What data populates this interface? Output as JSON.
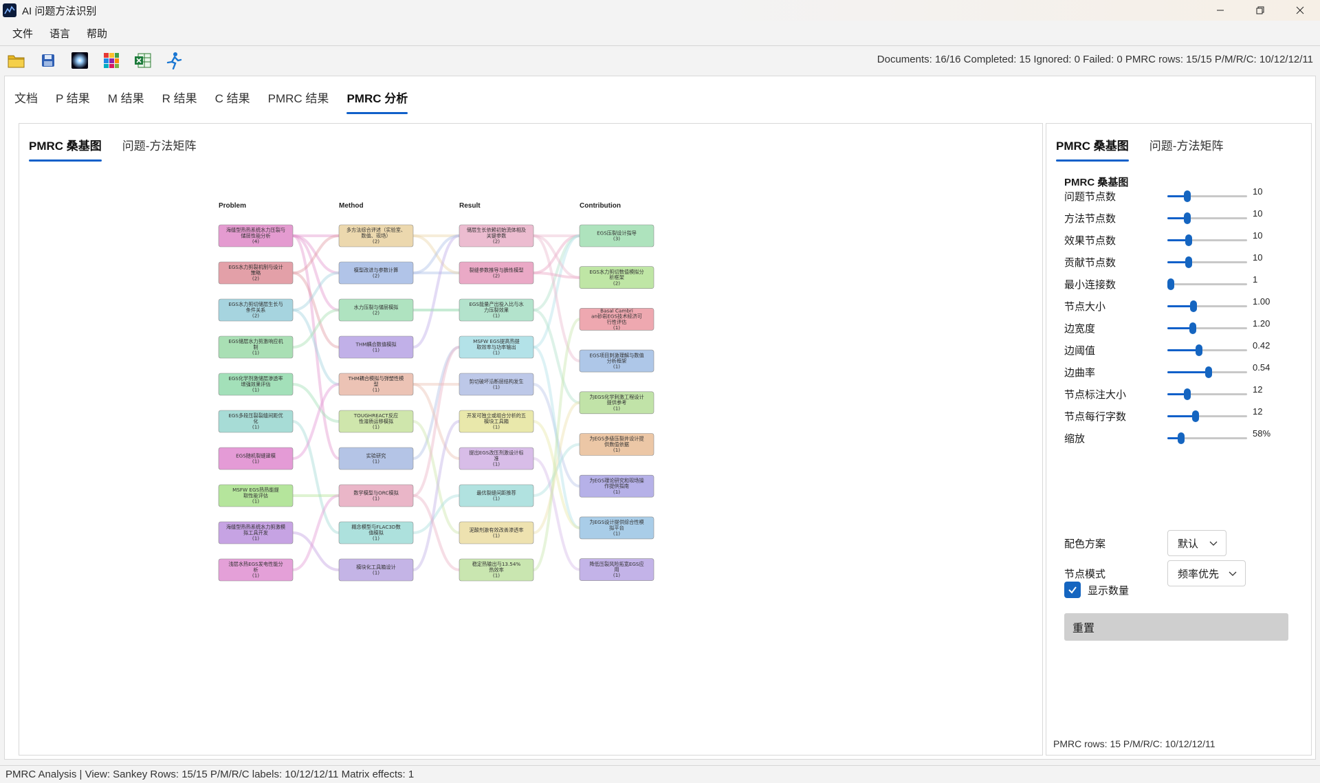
{
  "window": {
    "title": "AI 问题方法识别"
  },
  "menu": [
    "文件",
    "语言",
    "帮助"
  ],
  "toolbar": {
    "icons": [
      "folder-icon",
      "save-icon",
      "glow-icon",
      "palette-grid-icon",
      "excel-icon",
      "run-icon"
    ],
    "stats": "Documents: 16/16  Completed: 15  Ignored: 0  Failed: 0  PMRC rows: 15/15  P/M/R/C: 10/12/12/11"
  },
  "tabs": [
    {
      "label": "文档"
    },
    {
      "label": "P 结果"
    },
    {
      "label": "M 结果"
    },
    {
      "label": "R 结果"
    },
    {
      "label": "C 结果"
    },
    {
      "label": "PMRC 结果"
    },
    {
      "label": "PMRC 分析"
    }
  ],
  "active_tab": 6,
  "inner_tabs": [
    {
      "label": "PMRC 桑基图"
    },
    {
      "label": "问题-方法矩阵"
    }
  ],
  "sankey": {
    "columns": [
      "Problem",
      "Method",
      "Result",
      "Contribution"
    ],
    "problem": [
      {
        "text": "海缝型热热系统水力压裂与储层性能分析",
        "count": "(4)",
        "color": "#e49bd0"
      },
      {
        "text": "EGS水力剪裂机制与设计策略",
        "count": "(2)",
        "color": "#e3a0a8"
      },
      {
        "text": "EGS水力剪切储层生长与条件关系",
        "count": "(2)",
        "color": "#a6d4df"
      },
      {
        "text": "EGS储层水力剪激响应机制",
        "count": "(1)",
        "color": "#a9dfb4"
      },
      {
        "text": "EGS化学剂激储层渗透率增强效果评估",
        "count": "(1)",
        "color": "#a3e0b9"
      },
      {
        "text": "EGS多段压裂裂缝间距优化",
        "count": "(1)",
        "color": "#a7dcd6"
      },
      {
        "text": "EGS随机裂缝建模",
        "count": "(1)",
        "color": "#e49bd6"
      },
      {
        "text": "MSFW EGS热热能提取性能评估",
        "count": "(1)",
        "color": "#b5e59c"
      },
      {
        "text": "海缝型热热系统水力剪激模拟工具开发",
        "count": "(1)",
        "color": "#c6a3e3"
      },
      {
        "text": "浅层水热EGS发电性能分析",
        "count": "(1)",
        "color": "#e4a0d8"
      }
    ],
    "method": [
      {
        "text": "多方法综合评述（实验室、数值、现场）",
        "count": "(2)",
        "color": "#ecd8ae"
      },
      {
        "text": "模型改进与参数计算",
        "count": "(2)",
        "color": "#b1c4e8"
      },
      {
        "text": "水力压裂与储层模拟",
        "count": "(2)",
        "color": "#afe3c0"
      },
      {
        "text": "THM耦合数值模拟",
        "count": "(1)",
        "color": "#c1b0e8"
      },
      {
        "text": "THM耦合模拟与弹塑性模型",
        "count": "(1)",
        "color": "#ecc3b5"
      },
      {
        "text": "TOUGHREACT反应性溶质运移模拟",
        "count": "(1)",
        "color": "#cfe6ac"
      },
      {
        "text": "实验研究",
        "count": "(1)",
        "color": "#b4c4e6"
      },
      {
        "text": "数学模型与ORC模拟",
        "count": "(1)",
        "color": "#eab6c8"
      },
      {
        "text": "概念模型与FLAC3D数值模拟",
        "count": "(1)",
        "color": "#ade1dd"
      },
      {
        "text": "模块化工具箱设计",
        "count": "(1)",
        "color": "#c4b4e6"
      }
    ],
    "result": [
      {
        "text": "储层生长依赖初始流体相及关键参数",
        "count": "(2)",
        "color": "#ecbcd0"
      },
      {
        "text": "裂缝参数推导与脆性模型",
        "count": "(2)",
        "color": "#eaa9c6"
      },
      {
        "text": "EGS能量产出投入比与水力压裂效果",
        "count": "(1)",
        "color": "#b3e3cc"
      },
      {
        "text": "MSFW EGS提高热提取效率与功率输出",
        "count": "(1)",
        "color": "#b3e2e8"
      },
      {
        "text": "剪切破坏沿断层结构发生",
        "count": "(1)",
        "color": "#bdc8e8"
      },
      {
        "text": "开发可独立或组合分析的五模块工具箱",
        "count": "(1)",
        "color": "#e9e8ab"
      },
      {
        "text": "提出EGS改压剂激设计标准",
        "count": "(1)",
        "color": "#d8bde8"
      },
      {
        "text": "最优裂缝间距推荐",
        "count": "(1)",
        "color": "#b1e2e0"
      },
      {
        "text": "泥酸剂激有效改善渗透率",
        "count": "(1)",
        "color": "#eee2b0"
      },
      {
        "text": "稳定热输出与13.54%热效率",
        "count": "(1)",
        "color": "#c9e6b0"
      }
    ],
    "contribution": [
      {
        "text": "EGS压裂设计指导",
        "count": "(3)",
        "color": "#aee3bd"
      },
      {
        "text": "EGS水力剪切数值模拟分析框架",
        "count": "(2)",
        "color": "#bfe6a5"
      },
      {
        "text": "Basal Cambrian砂岩EGS技术经济可行性评估",
        "count": "(1)",
        "color": "#eea8b0"
      },
      {
        "text": "EGS项目刺激理解与数值分析框架",
        "count": "(1)",
        "color": "#aec7e8"
      },
      {
        "text": "为EGS化学刺激工程设计提供参考",
        "count": "(1)",
        "color": "#c1e3a8"
      },
      {
        "text": "为EGS多级压裂井设计提供数值依据",
        "count": "(1)",
        "color": "#ecc7a6"
      },
      {
        "text": "为EGS理论研究和现场操作提供指南",
        "count": "(1)",
        "color": "#b6b1e8"
      },
      {
        "text": "为EGS设计提供综合性模拟平台",
        "count": "(1)",
        "color": "#a9cde8"
      },
      {
        "text": "降低压裂风险拓宽EGS应用",
        "count": "(1)",
        "color": "#c3b3e8"
      }
    ],
    "links": [
      [
        0,
        0,
        0,
        0
      ],
      [
        0,
        1,
        1,
        0
      ],
      [
        0,
        2,
        2,
        0
      ],
      [
        0,
        6,
        3,
        0
      ],
      [
        1,
        0,
        1,
        1
      ],
      [
        1,
        3,
        0,
        1
      ],
      [
        2,
        1,
        0,
        3
      ],
      [
        2,
        4,
        4,
        6
      ],
      [
        3,
        2,
        2,
        4
      ],
      [
        4,
        5,
        8,
        4
      ],
      [
        5,
        8,
        7,
        5
      ],
      [
        6,
        4,
        6,
        8
      ],
      [
        7,
        7,
        3,
        7
      ],
      [
        8,
        9,
        5,
        7
      ],
      [
        9,
        7,
        9,
        2
      ]
    ]
  },
  "controls": {
    "heading": "PMRC 桑基图",
    "sliders": [
      {
        "label": "问题节点数",
        "value": "10",
        "pos": 0.25
      },
      {
        "label": "方法节点数",
        "value": "10",
        "pos": 0.25
      },
      {
        "label": "效果节点数",
        "value": "10",
        "pos": 0.27
      },
      {
        "label": "贡献节点数",
        "value": "10",
        "pos": 0.27
      },
      {
        "label": "最小连接数",
        "value": "1",
        "pos": 0.04
      },
      {
        "label": "节点大小",
        "value": "1.00",
        "pos": 0.33
      },
      {
        "label": "边宽度",
        "value": "1.20",
        "pos": 0.32
      },
      {
        "label": "边阈值",
        "value": "0.42",
        "pos": 0.4
      },
      {
        "label": "边曲率",
        "value": "0.54",
        "pos": 0.52
      },
      {
        "label": "节点标注大小",
        "value": "12",
        "pos": 0.25
      },
      {
        "label": "节点每行字数",
        "value": "12",
        "pos": 0.35
      },
      {
        "label": "缩放",
        "value": "58%",
        "pos": 0.17
      }
    ],
    "color_scheme": {
      "label": "配色方案",
      "value": "默认"
    },
    "node_mode": {
      "label": "节点模式",
      "value": "频率优先"
    },
    "show_counts": {
      "label": "显示数量",
      "checked": true
    },
    "reset_label": "重置",
    "footer": "PMRC rows: 15  P/M/R/C: 10/12/12/11"
  },
  "statusbar": "PMRC Analysis | View: Sankey  Rows: 15/15  P/M/R/C labels: 10/12/12/11  Matrix effects: 1"
}
